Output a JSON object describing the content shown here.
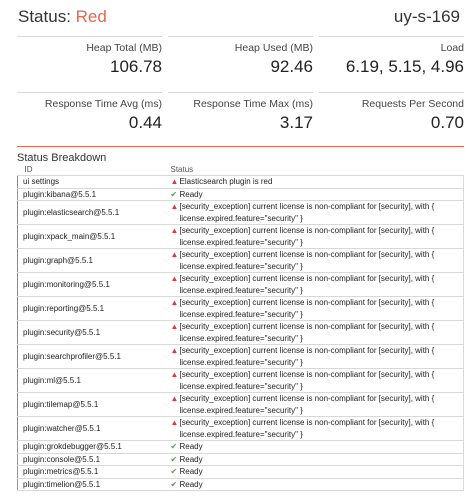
{
  "header": {
    "status_label": "Status: ",
    "status_value": "Red",
    "host": "uy-s-169"
  },
  "colors": {
    "status_red": "#e7664c",
    "ok_green": "#54a24b",
    "warn_red": "#d43f3a"
  },
  "metrics": [
    {
      "label": "Heap Total (MB)",
      "value": "106.78"
    },
    {
      "label": "Heap Used (MB)",
      "value": "92.46"
    },
    {
      "label": "Load",
      "value": "6.19, 5.15, 4.96"
    },
    {
      "label": "Response Time Avg (ms)",
      "value": "0.44"
    },
    {
      "label": "Response Time Max (ms)",
      "value": "3.17"
    },
    {
      "label": "Requests Per Second",
      "value": "0.70"
    }
  ],
  "breakdown": {
    "title": "Status Breakdown",
    "columns": {
      "id": "ID",
      "status": "Status"
    },
    "rows": [
      {
        "id": "ui settings",
        "state": "red",
        "icon": "warning-icon",
        "message": "Elasticsearch plugin is red"
      },
      {
        "id": "plugin:kibana@5.5.1",
        "state": "green",
        "icon": "check-icon",
        "message": "Ready"
      },
      {
        "id": "plugin:elasticsearch@5.5.1",
        "state": "red",
        "icon": "warning-icon",
        "message": "[security_exception] current license is non-compliant for [security], with { license.expired.feature=\"security\" }"
      },
      {
        "id": "plugin:xpack_main@5.5.1",
        "state": "red",
        "icon": "warning-icon",
        "message": "[security_exception] current license is non-compliant for [security], with { license.expired.feature=\"security\" }"
      },
      {
        "id": "plugin:graph@5.5.1",
        "state": "red",
        "icon": "warning-icon",
        "message": "[security_exception] current license is non-compliant for [security], with { license.expired.feature=\"security\" }"
      },
      {
        "id": "plugin:monitoring@5.5.1",
        "state": "red",
        "icon": "warning-icon",
        "message": "[security_exception] current license is non-compliant for [security], with { license.expired.feature=\"security\" }"
      },
      {
        "id": "plugin:reporting@5.5.1",
        "state": "red",
        "icon": "warning-icon",
        "message": "[security_exception] current license is non-compliant for [security], with { license.expired.feature=\"security\" }"
      },
      {
        "id": "plugin:security@5.5.1",
        "state": "red",
        "icon": "warning-icon",
        "message": "[security_exception] current license is non-compliant for [security], with { license.expired.feature=\"security\" }"
      },
      {
        "id": "plugin:searchprofiler@5.5.1",
        "state": "red",
        "icon": "warning-icon",
        "message": "[security_exception] current license is non-compliant for [security], with { license.expired.feature=\"security\" }"
      },
      {
        "id": "plugin:ml@5.5.1",
        "state": "red",
        "icon": "warning-icon",
        "message": "[security_exception] current license is non-compliant for [security], with { license.expired.feature=\"security\" }"
      },
      {
        "id": "plugin:tilemap@5.5.1",
        "state": "red",
        "icon": "warning-icon",
        "message": "[security_exception] current license is non-compliant for [security], with { license.expired.feature=\"security\" }"
      },
      {
        "id": "plugin:watcher@5.5.1",
        "state": "red",
        "icon": "warning-icon",
        "message": "[security_exception] current license is non-compliant for [security], with { license.expired.feature=\"security\" }"
      },
      {
        "id": "plugin:grokdebugger@5.5.1",
        "state": "green",
        "icon": "check-icon",
        "message": "Ready"
      },
      {
        "id": "plugin:console@5.5.1",
        "state": "green",
        "icon": "check-icon",
        "message": "Ready"
      },
      {
        "id": "plugin:metrics@5.5.1",
        "state": "green",
        "icon": "check-icon",
        "message": "Ready"
      },
      {
        "id": "plugin:timelion@5.5.1",
        "state": "green",
        "icon": "check-icon",
        "message": "Ready"
      }
    ]
  }
}
